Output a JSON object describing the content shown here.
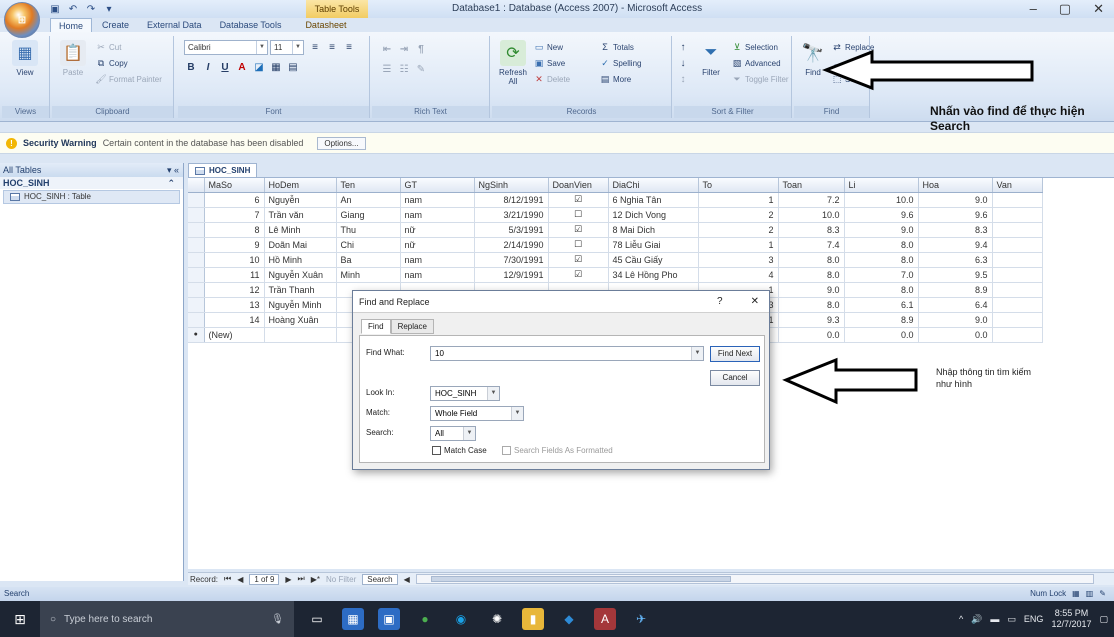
{
  "window": {
    "title": "Database1 : Database (Access 2007) - Microsoft Access",
    "context_tools": "Table Tools",
    "controls": [
      "–",
      "▢",
      "✕"
    ]
  },
  "tabs": [
    {
      "label": "Home",
      "active": true
    },
    {
      "label": "Create",
      "active": false
    },
    {
      "label": "External Data",
      "active": false
    },
    {
      "label": "Database Tools",
      "active": false
    },
    {
      "label": "Datasheet",
      "active": false
    }
  ],
  "ribbon": {
    "views": {
      "view_label": "View",
      "group": "Views"
    },
    "clipboard": {
      "paste": "Paste",
      "cut": "Cut",
      "copy": "Copy",
      "format_painter": "Format Painter",
      "group": "Clipboard"
    },
    "font": {
      "font_name": "Calibri",
      "font_size": "11",
      "group": "Font"
    },
    "rich_text": {
      "group": "Rich Text"
    },
    "records": {
      "refresh": "Refresh All",
      "new": "New",
      "save": "Save",
      "delete": "Delete",
      "totals": "Totals",
      "spelling": "Spelling",
      "more": "More",
      "group": "Records"
    },
    "sort_filter": {
      "filter": "Filter",
      "selection": "Selection",
      "advanced": "Advanced",
      "toggle_filter": "Toggle Filter",
      "group": "Sort & Filter"
    },
    "find": {
      "find": "Find",
      "replace": "Replace",
      "select": "Select",
      "group": "Find"
    }
  },
  "security": {
    "label": "Security Warning",
    "text": "Certain content in the database has been disabled",
    "options": "Options..."
  },
  "nav": {
    "header": "All Tables",
    "group": "HOC_SINH",
    "item": "HOC_SINH : Table"
  },
  "doc_tab": "HOC_SINH",
  "grid": {
    "columns": [
      "MaSo",
      "HoDem",
      "Ten",
      "GT",
      "NgSinh",
      "DoanVien",
      "DiaChi",
      "To",
      "Toan",
      "Li",
      "Hoa",
      "Van"
    ],
    "rows": [
      [
        "6",
        "Nguyễn",
        "An",
        "nam",
        "8/12/1991",
        "☑",
        "6 Nghia Tân",
        "1",
        "7.2",
        "10.0",
        "9.0",
        ""
      ],
      [
        "7",
        "Trần văn",
        "Giang",
        "nam",
        "3/21/1990",
        "☐",
        "12 Dich Vong",
        "2",
        "10.0",
        "9.6",
        "9.6",
        ""
      ],
      [
        "8",
        "Lê Minh",
        "Thu",
        "nữ",
        "5/3/1991",
        "☑",
        "8 Mai Dich",
        "2",
        "8.3",
        "9.0",
        "8.3",
        ""
      ],
      [
        "9",
        "Doãn Mai",
        "Chi",
        "nữ",
        "2/14/1990",
        "☐",
        "78 Liễu Giai",
        "1",
        "7.4",
        "8.0",
        "9.4",
        ""
      ],
      [
        "10",
        "Hồ Minh",
        "Ba",
        "nam",
        "7/30/1991",
        "☑",
        "45 Cầu Giấy",
        "3",
        "8.0",
        "8.0",
        "6.3",
        ""
      ],
      [
        "11",
        "Nguyễn Xuân",
        "Minh",
        "nam",
        "12/9/1991",
        "☑",
        "34 Lê Hồng Pho",
        "4",
        "8.0",
        "7.0",
        "9.5",
        ""
      ],
      [
        "12",
        "Trần Thanh",
        "",
        "",
        "",
        "",
        "",
        "1",
        "9.0",
        "8.0",
        "8.9",
        ""
      ],
      [
        "13",
        "Nguyễn Minh",
        "",
        "",
        "",
        "",
        "",
        "3",
        "8.0",
        "6.1",
        "6.4",
        ""
      ],
      [
        "14",
        "Hoàng Xuân",
        "",
        "",
        "",
        "",
        "",
        "1",
        "9.3",
        "8.9",
        "9.0",
        ""
      ]
    ],
    "new_row": {
      "label": "(New)",
      "toan": "0.0",
      "li": "0.0",
      "hoa": "0.0"
    }
  },
  "record_nav": {
    "label": "Record: ",
    "position": "1 of 9",
    "filter": "No Filter",
    "search": "Search"
  },
  "status": {
    "left": "Search",
    "right": "Num Lock"
  },
  "dialog": {
    "title": "Find and Replace",
    "help": "?",
    "close": "✕",
    "tabs": [
      "Find",
      "Replace"
    ],
    "find_what_label": "Find What:",
    "find_what_value": "10",
    "look_in_label": "Look In:",
    "look_in_value": "HOC_SINH",
    "match_label": "Match:",
    "match_value": "Whole Field",
    "search_label": "Search:",
    "search_value": "All",
    "match_case": "Match Case",
    "search_formatted": "Search Fields As Formatted",
    "find_next": "Find Next",
    "cancel": "Cancel"
  },
  "annotations": {
    "top": "Nhấn vào find để thực hiện Search",
    "right": "Nhập thông tin tìm kiếm như hình"
  },
  "taskbar": {
    "search_placeholder": "Type here to search",
    "lang": "ENG",
    "time": "8:55 PM",
    "date": "12/7/2017"
  }
}
